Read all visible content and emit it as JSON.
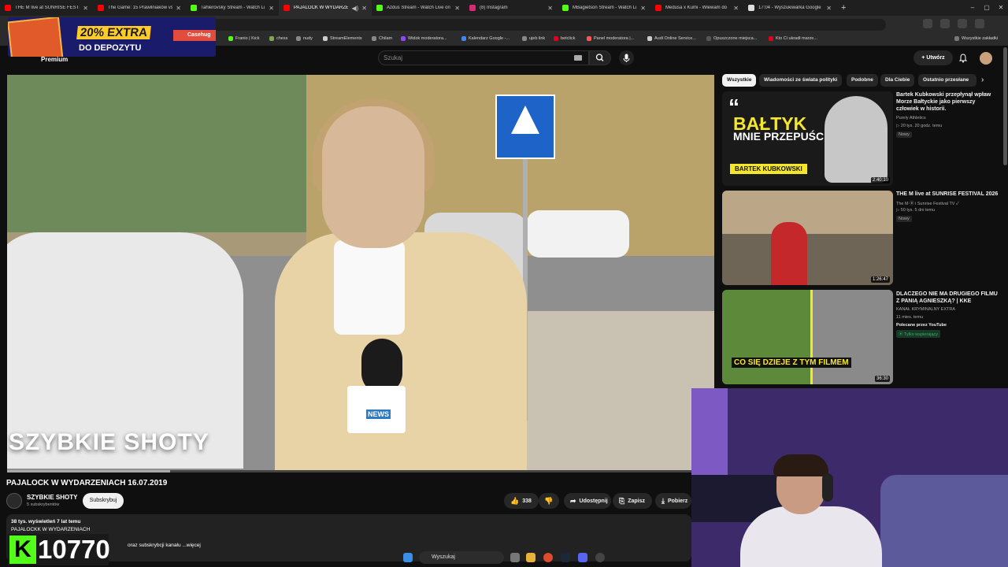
{
  "browser": {
    "tabs": [
      {
        "title": "THE M live at SUNRISE FESTIVAL",
        "favicon_color": "#ff0000",
        "active": false
      },
      {
        "title": "The Game: 15 Prawilniaków vs",
        "favicon_color": "#ff0000",
        "active": false
      },
      {
        "title": "Tahlerovsky Stream - Watch Li",
        "favicon_color": "#53fc18",
        "active": false
      },
      {
        "title": "PAJALOCK W WYDARZENI",
        "favicon_color": "#ff0000",
        "active": true
      },
      {
        "title": "Azdus Stream - Watch Live on",
        "favicon_color": "#53fc18",
        "active": false
      },
      {
        "title": "(8) Instagram",
        "favicon_color": "#d62976",
        "active": false
      },
      {
        "title": "MBagietson Stream - Watch Li",
        "favicon_color": "#53fc18",
        "active": false
      },
      {
        "title": "Medusa x Kumi - Wlewam do",
        "favicon_color": "#ff0000",
        "active": false
      },
      {
        "title": "17:04 - Wyszukiwarka Google",
        "favicon_color": "#dddddd",
        "active": false
      }
    ],
    "new_tab_glyph": "+",
    "window_controls": [
      "–",
      "▢",
      "✕"
    ],
    "bookmarks": [
      {
        "label": "Franio | Kick",
        "color": "#53fc18"
      },
      {
        "label": "chess",
        "color": "#7fa650"
      },
      {
        "label": "nudy",
        "color": "#888888"
      },
      {
        "label": "StreamElements",
        "color": "#cccccc"
      },
      {
        "label": "Chilam",
        "color": "#888888"
      },
      {
        "label": "Widok moderatora...",
        "color": "#9146ff"
      },
      {
        "label": "Kalendarz Google -...",
        "color": "#4285f4"
      },
      {
        "label": "ujeb link",
        "color": "#888888"
      },
      {
        "label": "betclick",
        "color": "#e2001a"
      },
      {
        "label": "Panel moderatora |...",
        "color": "#ff5555"
      },
      {
        "label": "Audi Online Service...",
        "color": "#cccccc"
      },
      {
        "label": "Opuszczone miejsca...",
        "color": "#555555"
      },
      {
        "label": "Kto Ci ukradł marze...",
        "color": "#e2001a"
      }
    ],
    "all_bookmarks_label": "Wszystkie zakładki"
  },
  "ad": {
    "percent_text": "20% EXTRA",
    "deposit_text": "DO DEPOZYTU",
    "brand_text": "Casehug"
  },
  "youtube": {
    "logo_suffix": "Premium",
    "search_placeholder": "Szukaj",
    "create_label": "Utwórz",
    "video": {
      "overlay_text": "SZYBKIE SHOTY",
      "progress": 0.23,
      "title": "PAJALOCK W WYDARZENIACH 16.07.2019",
      "channel_name": "SZYBKIE SHOTY",
      "channel_subs": "5 subskrybentów",
      "subscribe_label": "Subskrybuj",
      "likes": "338",
      "share_label": "Udostępnij",
      "save_label": "Zapisz",
      "download_label": "Pobierz",
      "views_line": "38 tys. wyświetleń  7 lat temu",
      "desc_title": "PAJALOCKK W WYDARZENIACH",
      "desc_tail": "oraz subskrybcji kanału ...więcej"
    },
    "chips": [
      "Wszystkie",
      "Wiadomości ze świata polityki",
      "Podobne",
      "Dla Ciebie",
      "Ostatnio przesłane"
    ],
    "chip_next_glyph": "›",
    "recommendations": [
      {
        "title": "Bartek Kubkowski przepłynął wpław Morze Bałtyckie jako pierwszy człowiek w historii.",
        "channel": "Purely Athletics",
        "meta": "▷ 20 tys.  20 godz. temu",
        "badge": "Nowy",
        "duration": "2:40:10",
        "thumb_quote": "“",
        "thumb_big": "BAŁTYK",
        "thumb_small": "MNIE PRZEPUŚCIŁ",
        "thumb_label": "BARTEK KUBKOWSKI"
      },
      {
        "title": "THE M live at SUNRISE FESTIVAL 2026",
        "channel": "The M ⦿ i Sunrise Festival TV ✓",
        "meta": "▷ 50 tys.  5 dni temu",
        "badge": "Nowy",
        "duration": "1:26:47"
      },
      {
        "title": "DLACZEGO NIE MA DRUGIEGO FILMU Z PANIĄ AGNIESZKĄ? | KKE",
        "channel": "KANAŁ KRYMINALNY EXTRA",
        "meta": "11 mies. temu",
        "extra": "Polecane przez YouTube",
        "badge": "⦿ Tylko wspierający",
        "duration": "36:30",
        "thumb_text": "CO SIĘ DZIEJE Z TYM FILMEM"
      }
    ]
  },
  "overlay": {
    "kick_letter": "K",
    "counter": "10770"
  },
  "taskbar": {
    "search_label": "Wyszukaj"
  }
}
